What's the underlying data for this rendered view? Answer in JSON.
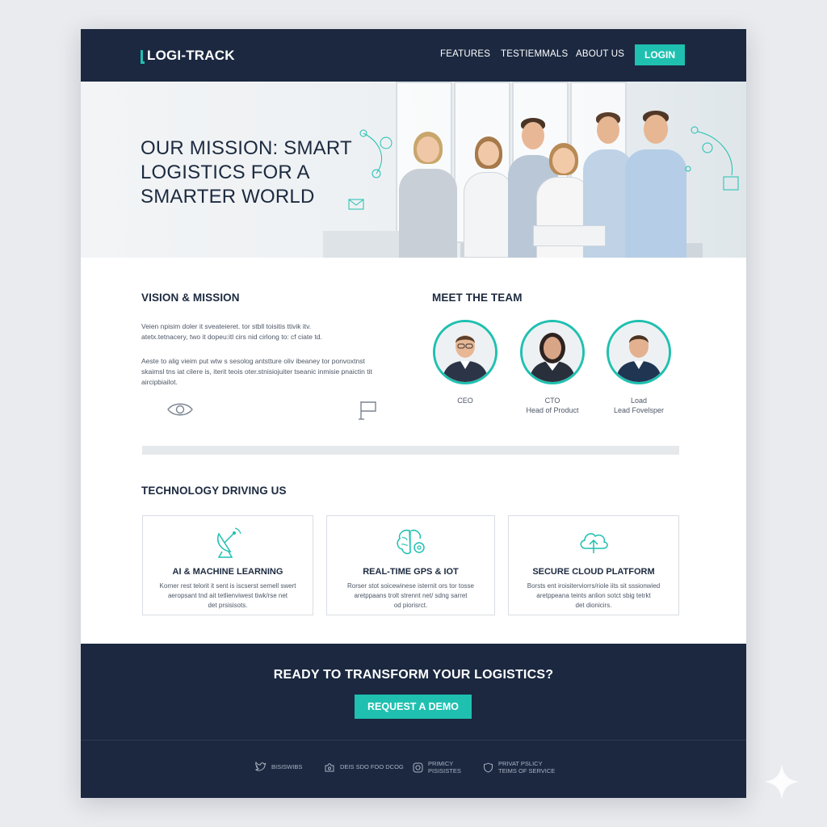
{
  "colors": {
    "navy": "#1b2840",
    "accent": "#1fc0b0",
    "text": "#1c2a3f",
    "muted": "#4d5766"
  },
  "nav": {
    "logo": "LOGI-TRACK",
    "links": [
      "FEATURES",
      "TESTIEMMALS",
      "ABOUT US"
    ],
    "login": "LOGIN"
  },
  "hero": {
    "title_lines": [
      "OUR MISSION: SMART",
      "LOGISTICS FOR A",
      "SMARTER WORLD"
    ]
  },
  "vision": {
    "title": "VISION & MISSION",
    "para1": [
      "Veien npisim doler it sveateieret. tor stbll toisitis ttivik itv.",
      "atetx.tetnacery, two it dopeu:itl cirs nid cirlong to: cf ciate td."
    ],
    "para2": [
      "Aeste to alig vieim put wtw s sesolog antstture oliv ibeaney tor ponvoxtnst",
      "skaimsl tns iat cilere is, iterit teois oter.stnisiojuiter tseanic inmisie pnaictin tit",
      "aircipbiailot."
    ],
    "icons": [
      "eye-icon",
      "flag-icon"
    ]
  },
  "team": {
    "title": "MEET THE TEAM",
    "members": [
      {
        "role": "CEO",
        "subtitle": ""
      },
      {
        "role": "CTO",
        "subtitle": "Head of Product"
      },
      {
        "role": "Load",
        "subtitle": "Lead Fovelsper"
      }
    ]
  },
  "tech": {
    "title": "TECHNOLOGY DRIVING US",
    "cards": [
      {
        "icon": "satellite-dish-icon",
        "title": "AI & MACHINE LEARNING",
        "desc": [
          "Korner rest telorit it sent is iscserst semell swert",
          "aeropsant tnd ait tetlienviwest tiwk/rse net",
          "det prsisisots."
        ]
      },
      {
        "icon": "brain-gear-icon",
        "title": "REAL-TIME GPS & IOT",
        "desc": [
          "Rorser stot soicewinese isternit ors tor tosse",
          "aretppaans trolt strennt net/ sdng sarret",
          "od piorisrct."
        ]
      },
      {
        "icon": "cloud-upload-icon",
        "title": "SECURE CLOUD PLATFORM",
        "desc": [
          "Borsts ent iroisiterviorrs/riole iits sit sssionwied",
          "aretppeana teints anlion sotct sbig tetrkt",
          "det dionicirs."
        ]
      }
    ]
  },
  "cta": {
    "title": "READY TO TRANSFORM YOUR LOGISTICS?",
    "button": "REQUEST A DEMO"
  },
  "footer": {
    "items": [
      {
        "icon": "twitter-icon",
        "lines": [
          "BISISWIBS"
        ]
      },
      {
        "icon": "puzzle-icon",
        "lines": [
          "DEIS SDO FOO DCOG"
        ]
      },
      {
        "icon": "instagram-icon",
        "lines": [
          "PRIMICY",
          "PISISISTES"
        ]
      },
      {
        "icon": "shield-icon",
        "lines": [
          "PRIVAT PSLICY",
          "TEIMS OF SERVICE"
        ]
      }
    ]
  }
}
